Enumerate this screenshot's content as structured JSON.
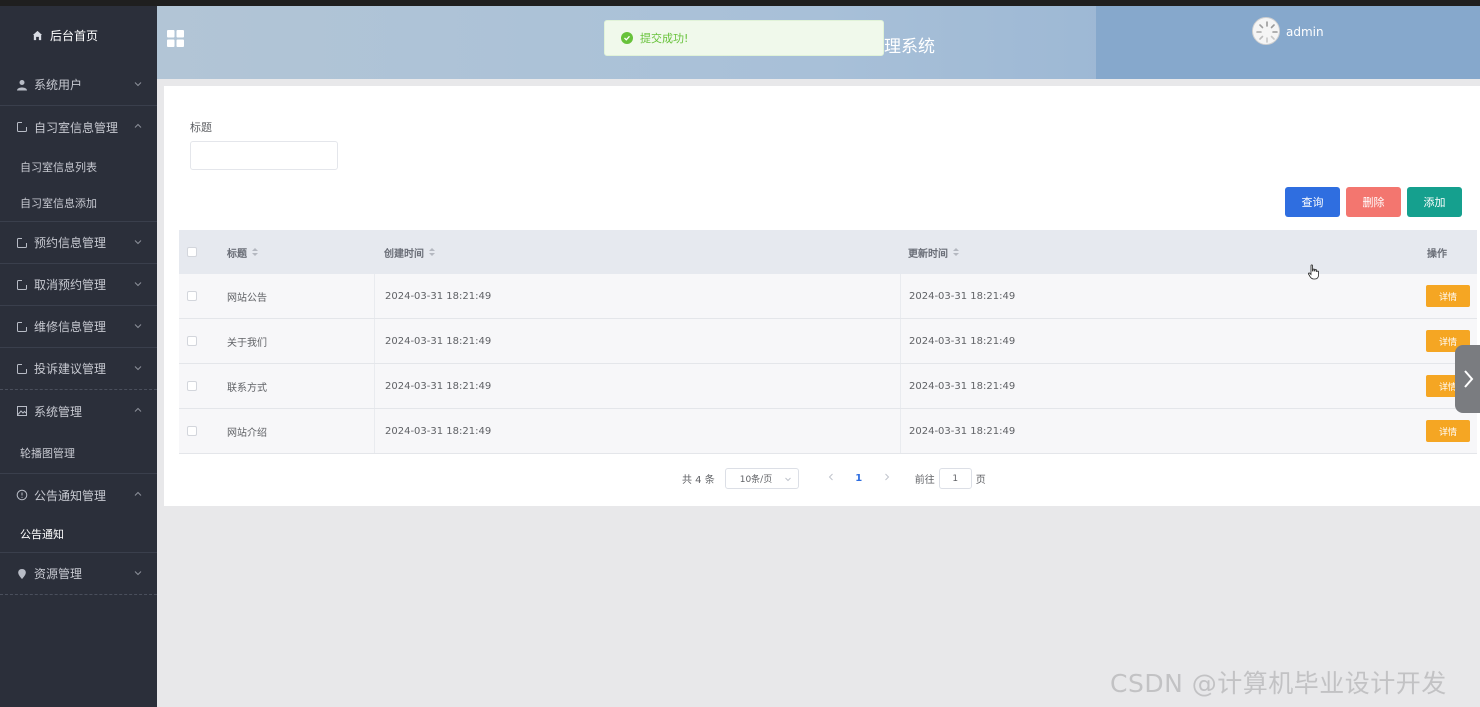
{
  "sidebar": {
    "home": "后台首页",
    "items": [
      {
        "label": "系统用户",
        "icon": "user-icon",
        "expanded": false,
        "children": []
      },
      {
        "label": "自习室信息管理",
        "icon": "document-icon",
        "expanded": true,
        "children": [
          "自习室信息列表",
          "自习室信息添加"
        ]
      },
      {
        "label": "预约信息管理",
        "icon": "document-icon",
        "expanded": false,
        "children": []
      },
      {
        "label": "取消预约管理",
        "icon": "document-icon",
        "expanded": false,
        "children": []
      },
      {
        "label": "维修信息管理",
        "icon": "document-icon",
        "expanded": false,
        "children": []
      },
      {
        "label": "投诉建议管理",
        "icon": "document-icon",
        "expanded": false,
        "children": []
      },
      {
        "label": "系统管理",
        "icon": "picture-icon",
        "expanded": true,
        "children": [
          "轮播图管理"
        ]
      },
      {
        "label": "公告通知管理",
        "icon": "info-icon",
        "expanded": true,
        "children": [
          "公告通知"
        ],
        "active_child": "公告通知"
      },
      {
        "label": "资源管理",
        "icon": "location-icon",
        "expanded": false,
        "children": []
      }
    ]
  },
  "header": {
    "title": "理系统",
    "username": "admin"
  },
  "toast": {
    "message": "提交成功!"
  },
  "filter": {
    "label": "标题",
    "value": ""
  },
  "buttons": {
    "query": "查询",
    "delete": "删除",
    "add": "添加"
  },
  "table": {
    "columns": [
      "标题",
      "创建时间",
      "更新时间",
      "操作"
    ],
    "rows": [
      {
        "title": "网站公告",
        "created": "2024-03-31 18:21:49",
        "updated": "2024-03-31 18:21:49",
        "action": "详情"
      },
      {
        "title": "关于我们",
        "created": "2024-03-31 18:21:49",
        "updated": "2024-03-31 18:21:49",
        "action": "详情"
      },
      {
        "title": "联系方式",
        "created": "2024-03-31 18:21:49",
        "updated": "2024-03-31 18:21:49",
        "action": "详情"
      },
      {
        "title": "网站介绍",
        "created": "2024-03-31 18:21:49",
        "updated": "2024-03-31 18:21:49",
        "action": "详情"
      }
    ]
  },
  "pagination": {
    "total": "共 4 条",
    "page_size": "10条/页",
    "current": "1",
    "goto_label": "前往",
    "goto_value": "1",
    "unit": "页"
  },
  "watermark": "CSDN @计算机毕业设计开发",
  "colors": {
    "sidebar_bg": "#2b2f3a",
    "primary": "#2f6ee0",
    "danger": "#f3766f",
    "success": "#15a08e",
    "warning": "#f5a623",
    "toast_text": "#67c23a"
  }
}
